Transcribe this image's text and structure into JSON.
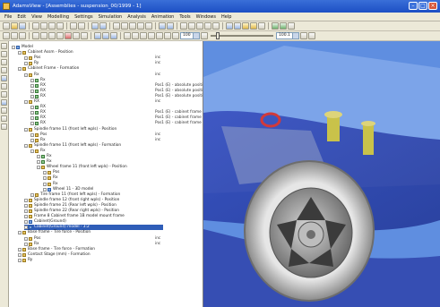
{
  "window": {
    "title": "AdamsView - [Assemblies - suspension_00/1999 - 1]"
  },
  "menu": [
    "File",
    "Edit",
    "View",
    "Modelling",
    "Settings",
    "Simulation",
    "Analysis",
    "Animation",
    "Tools",
    "Windows",
    "Help"
  ],
  "toolbar": {
    "zoom_value": "100",
    "frame_value": "100.1"
  },
  "tree": [
    {
      "text": "Model",
      "indent": 0,
      "icon": "b"
    },
    {
      "text": "Cabinet Assm - Position",
      "indent": 1,
      "icon": "y"
    },
    {
      "text": "Pos",
      "indent": 2,
      "icon": "y",
      "val": "inc"
    },
    {
      "text": "Ry",
      "indent": 2,
      "icon": "y",
      "val": "inc"
    },
    {
      "text": "Cabinet Frame - Formation",
      "indent": 1,
      "icon": "y"
    },
    {
      "text": "Rx",
      "indent": 2,
      "icon": "y",
      "val": "inc"
    },
    {
      "text": "Rx",
      "indent": 3,
      "icon": "g"
    },
    {
      "text": "RX",
      "indent": 3,
      "icon": "g",
      "val": "Pos1 (E) - absolute positio"
    },
    {
      "text": "RX",
      "indent": 3,
      "icon": "g",
      "val": "Pos1 (E) - absolute positio"
    },
    {
      "text": "RX",
      "indent": 3,
      "icon": "g",
      "val": "Pos1 (E) - absolute positio"
    },
    {
      "text": "RX",
      "indent": 2,
      "icon": "y",
      "val": "inc"
    },
    {
      "text": "RX",
      "indent": 3,
      "icon": "g"
    },
    {
      "text": "RX",
      "indent": 3,
      "icon": "g",
      "val": "Pos1 (E) - cabinet frame ..."
    },
    {
      "text": "RX",
      "indent": 3,
      "icon": "g",
      "val": "Pos1 (E) - cabinet frame ..."
    },
    {
      "text": "RX",
      "indent": 3,
      "icon": "g",
      "val": "Pos1 (E) - cabinet frame ..."
    },
    {
      "text": "Spindle frame 11 (front left wpls) - Position",
      "indent": 2,
      "icon": "y"
    },
    {
      "text": "Pos",
      "indent": 3,
      "icon": "y",
      "val": "inc"
    },
    {
      "text": "Rx",
      "indent": 3,
      "icon": "y",
      "val": "inc"
    },
    {
      "text": "Spindle frame 11 (front left wpls) - Formation",
      "indent": 2,
      "icon": "y"
    },
    {
      "text": "Rx",
      "indent": 3,
      "icon": "y"
    },
    {
      "text": "Rx",
      "indent": 4,
      "icon": "g"
    },
    {
      "text": "Rx",
      "indent": 4,
      "icon": "g"
    },
    {
      "text": "Wheel frame 11 (front left wpls) - Position",
      "indent": 4,
      "icon": "y"
    },
    {
      "text": "Pos",
      "indent": 5,
      "icon": "y"
    },
    {
      "text": "Rx",
      "indent": 5,
      "icon": "y"
    },
    {
      "text": "Rx",
      "indent": 5,
      "icon": "y"
    },
    {
      "text": "Wheel 11 - 3D model",
      "indent": 5,
      "icon": "b"
    },
    {
      "text": "Tire frame 11 (front left wpls) - Formation",
      "indent": 3,
      "icon": "y"
    },
    {
      "text": "Spindle frame 12 (front right wpls) - Position",
      "indent": 2,
      "icon": "y"
    },
    {
      "text": "Spindle frame 21 (Rear left wpls) - Position",
      "indent": 2,
      "icon": "y"
    },
    {
      "text": "Spindle frame 22 (Rear right wpls) - Position",
      "indent": 2,
      "icon": "y"
    },
    {
      "text": "Frame 8 Cabinet frame 1B model mount frame",
      "indent": 2,
      "icon": "y"
    },
    {
      "text": "Cabinet(Ground)",
      "indent": 2,
      "icon": "b"
    },
    {
      "text": "Cabinet(Ground) model - 3:2",
      "indent": 2,
      "icon": "b",
      "selected": true
    },
    {
      "text": "Base frame - Tire force - Position",
      "indent": 1,
      "icon": "y"
    },
    {
      "text": "Pos",
      "indent": 2,
      "icon": "y",
      "val": "inc"
    },
    {
      "text": "Rx",
      "indent": 2,
      "icon": "y",
      "val": "inc"
    },
    {
      "text": "Base frame - Tire force - Formation",
      "indent": 1,
      "icon": "y"
    },
    {
      "text": "Contact Stage (mm) - Formation",
      "indent": 1,
      "icon": "y"
    },
    {
      "text": "Ry",
      "indent": 1,
      "icon": "y"
    }
  ]
}
